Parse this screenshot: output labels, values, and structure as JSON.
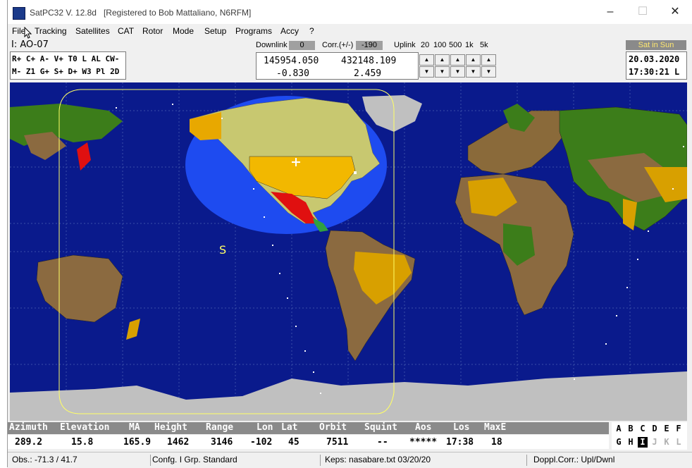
{
  "window": {
    "title": "SatPC32 V. 12.8d   [Registered to Bob Mattaliano, N6RFM]"
  },
  "controls": {
    "minimize": "–",
    "maximize": "☐",
    "close": "✕"
  },
  "menu": [
    "File",
    "Tracking",
    "Satellites",
    "CAT",
    "Rotor",
    "Mode",
    "Setup",
    "Programs",
    "Accy",
    "?"
  ],
  "satellite": {
    "label": "I: AO-07"
  },
  "keys_row1": "R+ C+ A- V+ T0 L AL CW-",
  "keys_row2": "M- Z1 G+ S+ D+ W3 Pl 2D",
  "freq": {
    "downlink_label": "Downlink",
    "downlink_val": "0",
    "corr_label": "Corr.(+/-)",
    "corr_val": "-190",
    "uplink_label": "Uplink",
    "steps": [
      "20",
      "100",
      "500",
      "1k",
      "5k"
    ],
    "down_freq": "145954.050",
    "up_freq": "432148.109",
    "down_doppler": "-0.830",
    "up_doppler": "2.459"
  },
  "status_box": {
    "sun": "Sat in Sun",
    "date": "20.03.2020",
    "time": "17:30:21 L"
  },
  "map": {
    "sun_marker": "S"
  },
  "table": {
    "headers": [
      "Azimuth",
      "Elevation",
      "MA",
      "Height",
      "Range",
      "Lon",
      "Lat",
      "Orbit",
      "Squint",
      "Aos",
      "Los",
      "MaxE"
    ],
    "values": [
      "289.2",
      "15.8",
      "165.9",
      "1462",
      "3146",
      "-102",
      "45",
      "7511",
      "--",
      "*****",
      "17:38",
      "18"
    ]
  },
  "letters_row1": [
    "A",
    "B",
    "C",
    "D",
    "E",
    "F"
  ],
  "letters_row2": [
    "G",
    "H",
    "I",
    "J",
    "K",
    "L"
  ],
  "statusbar": {
    "obs": "Obs.: -71.3 / 41.7",
    "config": "Confg. I  Grp. Standard",
    "keps": "Keps: nasabare.txt 03/20/20",
    "doppl": "Doppl.Corr.: Upl/Dwnl"
  },
  "colors": {
    "ocean": "#0a1a8c",
    "footprint": "#1e4bf0",
    "track": "#ffff66",
    "land": "#c8c870"
  }
}
